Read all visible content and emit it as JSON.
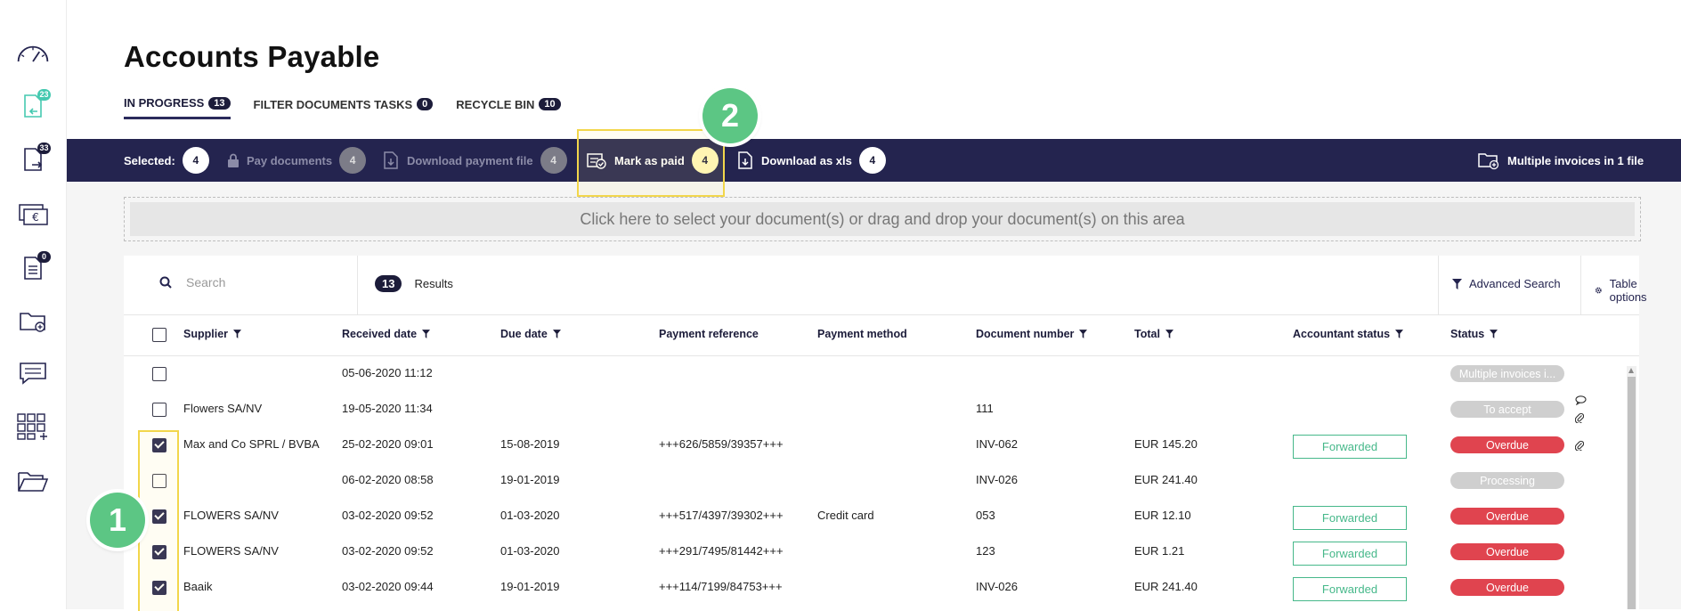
{
  "sidebar": {
    "items": [
      {
        "icon": "dashboard-gauge-icon"
      },
      {
        "icon": "incoming-documents-icon",
        "badge": "23"
      },
      {
        "icon": "outgoing-documents-icon",
        "badge": "33"
      },
      {
        "icon": "euro-payments-icon"
      },
      {
        "icon": "task-list-icon",
        "badge": "0"
      },
      {
        "icon": "folder-add-icon"
      },
      {
        "icon": "messages-icon"
      },
      {
        "icon": "apps-grid-icon"
      },
      {
        "icon": "open-folder-icon"
      }
    ]
  },
  "page": {
    "title": "Accounts Payable"
  },
  "tabs": [
    {
      "label": "IN PROGRESS",
      "count": "13"
    },
    {
      "label": "FILTER DOCUMENTS TASKS",
      "count": "0"
    },
    {
      "label": "RECYCLE BIN",
      "count": "10"
    }
  ],
  "action_bar": {
    "selected_label": "Selected:",
    "selected_count": "4",
    "pay_label": "Pay documents",
    "pay_count": "4",
    "download_payment_label": "Download payment file",
    "download_payment_count": "4",
    "mark_paid_label": "Mark as paid",
    "mark_paid_count": "4",
    "download_xls_label": "Download as xls",
    "download_xls_count": "4",
    "multiple_invoices_label": "Multiple invoices in 1 file"
  },
  "steps": {
    "one": "1",
    "two": "2"
  },
  "dropzone": {
    "text": "Click here to select your document(s) or drag and drop your document(s) on this area"
  },
  "toolbar": {
    "search_placeholder": "Search",
    "results_count": "13",
    "results_label": "Results",
    "advanced_search": "Advanced Search",
    "table_options": "Table options"
  },
  "table": {
    "headers": {
      "supplier": "Supplier",
      "received": "Received date",
      "due": "Due date",
      "payment_ref": "Payment reference",
      "payment_method": "Payment method",
      "doc_number": "Document number",
      "total": "Total",
      "accountant": "Accountant status",
      "status": "Status"
    },
    "rows": [
      {
        "checked": false,
        "supplier": "",
        "received": "05-06-2020 11:12",
        "due": "",
        "payment_ref": "",
        "payment_method": "",
        "doc_number": "",
        "total": "",
        "accountant": "",
        "status": "Multiple invoices i...",
        "status_color": "grey",
        "icons": []
      },
      {
        "checked": false,
        "supplier": "Flowers SA/NV",
        "received": "19-05-2020 11:34",
        "due": "",
        "payment_ref": "",
        "payment_method": "",
        "doc_number": "111",
        "total": "",
        "accountant": "",
        "status": "To accept",
        "status_color": "grey",
        "icons": [
          "comment-icon",
          "attachment-icon"
        ]
      },
      {
        "checked": true,
        "supplier": "Max and Co SPRL / BVBA",
        "received": "25-02-2020 09:01",
        "due": "15-08-2019",
        "payment_ref": "+++626/5859/39357+++",
        "payment_method": "",
        "doc_number": "INV-062",
        "total": "EUR 145.20",
        "accountant": "Forwarded",
        "status": "Overdue",
        "status_color": "red",
        "icons": [
          "attachment-icon"
        ]
      },
      {
        "checked": false,
        "supplier": "",
        "received": "06-02-2020 08:58",
        "due": "19-01-2019",
        "payment_ref": "",
        "payment_method": "",
        "doc_number": "INV-026",
        "total": "EUR 241.40",
        "accountant": "",
        "status": "Processing",
        "status_color": "grey",
        "icons": []
      },
      {
        "checked": true,
        "supplier": "FLOWERS SA/NV",
        "received": "03-02-2020 09:52",
        "due": "01-03-2020",
        "payment_ref": "+++517/4397/39302+++",
        "payment_method": "Credit card",
        "doc_number": "053",
        "total": "EUR 12.10",
        "accountant": "Forwarded",
        "status": "Overdue",
        "status_color": "red",
        "icons": []
      },
      {
        "checked": true,
        "supplier": "FLOWERS SA/NV",
        "received": "03-02-2020 09:52",
        "due": "01-03-2020",
        "payment_ref": "+++291/7495/81442+++",
        "payment_method": "",
        "doc_number": "123",
        "total": "EUR 1.21",
        "accountant": "Forwarded",
        "status": "Overdue",
        "status_color": "red",
        "icons": []
      },
      {
        "checked": true,
        "supplier": "Baaik",
        "received": "03-02-2020 09:44",
        "due": "19-01-2019",
        "payment_ref": "+++114/7199/84753+++",
        "payment_method": "",
        "doc_number": "INV-026",
        "total": "EUR 241.40",
        "accountant": "Forwarded",
        "status": "Overdue",
        "status_color": "red",
        "icons": []
      }
    ]
  },
  "colors": {
    "action_bar": "#24244f",
    "accent_green": "#46b88a",
    "overdue_red": "#e0444f",
    "highlight_yellow": "#f2d64b",
    "step_green": "#5cc684"
  }
}
